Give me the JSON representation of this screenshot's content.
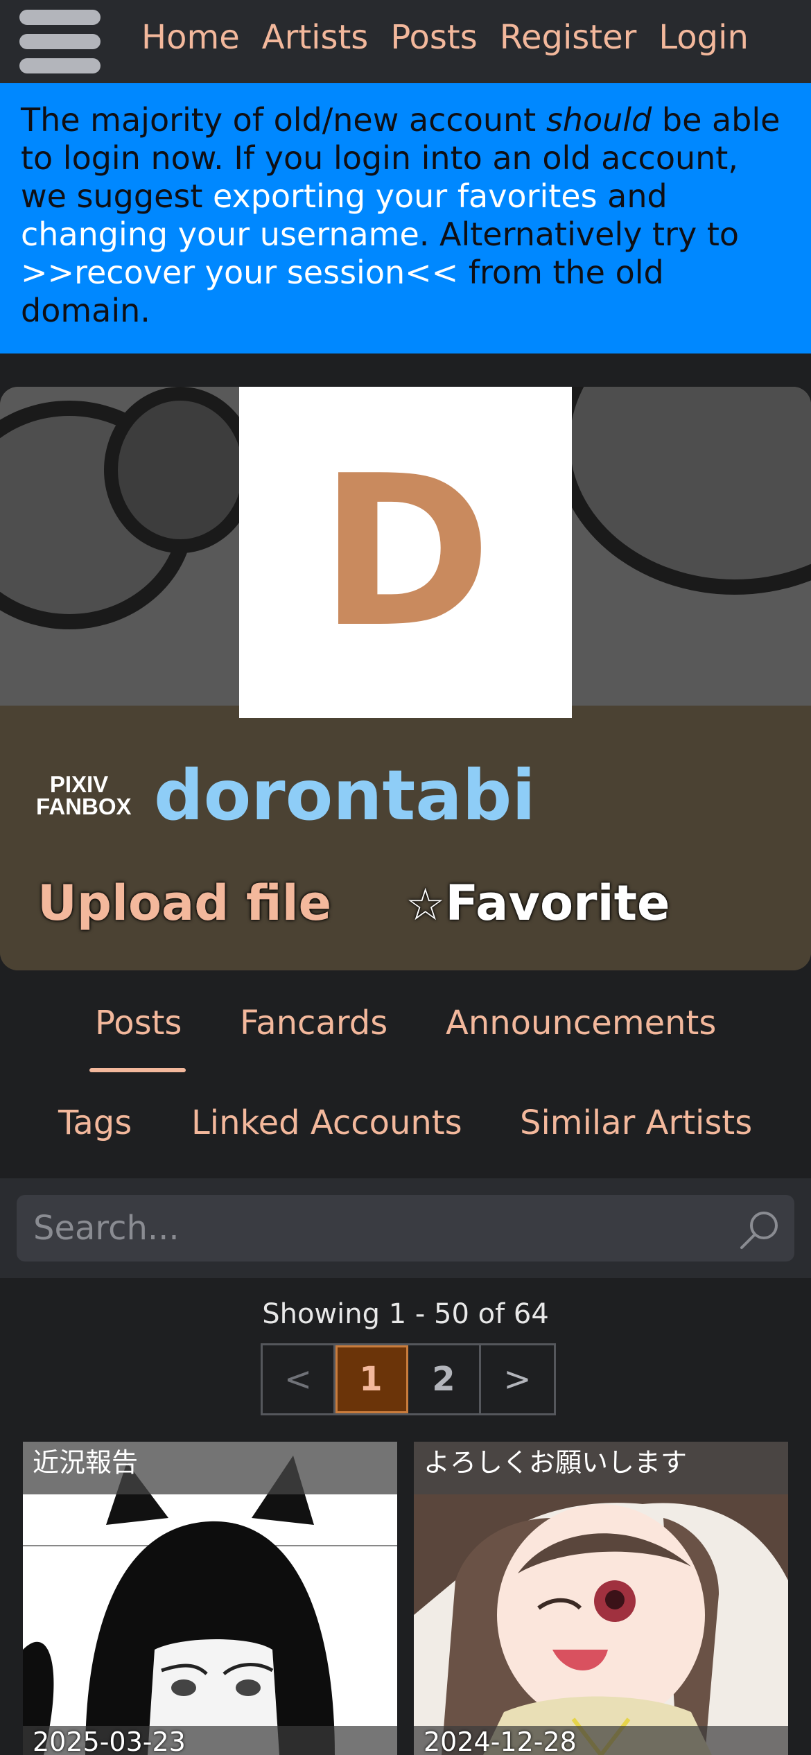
{
  "nav": {
    "items": [
      "Home",
      "Artists",
      "Posts",
      "Register",
      "Login"
    ]
  },
  "announcement": {
    "part1": "The majority of old/new account ",
    "emph": "should",
    "part2": " be able to login now. If you login into an old account, we suggest ",
    "link1": "exporting your favorites",
    "part3": " and ",
    "link2": "changing your username",
    "part4": ". Alternatively try to ",
    "link3": ">>recover your session<<",
    "part5": " from the old domain."
  },
  "artist": {
    "avatar_letter": "D",
    "service_line1": "PIXIV",
    "service_line2": "FANBOX",
    "name": "dorontabi",
    "upload_label": "Upload file",
    "favorite_star": "☆",
    "favorite_label": "Favorite"
  },
  "tabs": {
    "row1": [
      "Posts",
      "Fancards",
      "Announcements"
    ],
    "row2": [
      "Tags",
      "Linked Accounts",
      "Similar Artists"
    ],
    "active": "Posts"
  },
  "search": {
    "placeholder": "Search...",
    "icon": "search-icon"
  },
  "pagination": {
    "showing": "Showing 1 - 50 of 64",
    "prev": "<",
    "pages": [
      "1",
      "2"
    ],
    "current": "1",
    "next": ">"
  },
  "posts": [
    {
      "title": "近況報告",
      "date": "2025-03-23"
    },
    {
      "title": "よろしくお願いします",
      "date": "2024-12-28"
    }
  ],
  "colors": {
    "accent": "#f3b89c",
    "announcement_bg": "#0088ff",
    "artist_name": "#8ecdf7",
    "current_page_bg": "#6b3409"
  }
}
